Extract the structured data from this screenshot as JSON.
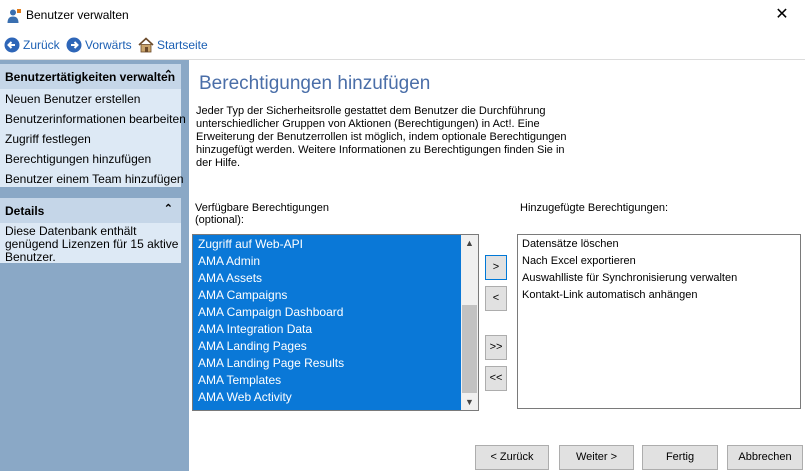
{
  "window": {
    "title": "Benutzer verwalten",
    "close_symbol": "✕"
  },
  "nav": {
    "back": "Zurück",
    "forward": "Vorwärts",
    "home": "Startseite"
  },
  "sidebar": {
    "tasks": {
      "heading": "Benutzertätigkeiten verwalten",
      "items": [
        "Neuen Benutzer erstellen",
        "Benutzerinformationen bearbeiten",
        "Zugriff festlegen",
        "Berechtigungen hinzufügen",
        "Benutzer einem Team hinzufügen"
      ]
    },
    "details": {
      "heading": "Details",
      "text": "Diese Datenbank enthält genügend Lizenzen für 15 aktive Benutzer."
    },
    "collapse_symbol": "⌃"
  },
  "main": {
    "title": "Berechtigungen hinzufügen",
    "intro": "Jeder Typ der Sicherheitsrolle gestattet dem Benutzer die Durchführung unterschiedlicher Gruppen von Aktionen (Berechtigungen) in Act!. Eine Erweiterung der Benutzerrollen ist möglich, indem optionale Berechtigungen hinzugefügt werden. Weitere Informationen zu Berechtigungen finden Sie in der Hilfe.",
    "available_label": "Verfügbare Berechtigungen (optional):",
    "added_label": "Hinzugefügte Berechtigungen:",
    "available_items": [
      "Zugriff auf Web-API",
      "AMA Admin",
      "AMA Assets",
      "AMA Campaigns",
      "AMA Campaign Dashboard",
      "AMA Integration Data",
      "AMA Landing Pages",
      "AMA Landing Page Results",
      "AMA Templates",
      "AMA Web Activity"
    ],
    "added_items": [
      "Datensätze löschen",
      "Nach Excel exportieren",
      "Auswahlliste für Synchronisierung verwalten",
      "Kontakt-Link automatisch anhängen"
    ],
    "move_buttons": {
      "add": ">",
      "remove": "<",
      "add_all": ">>",
      "remove_all": "<<"
    },
    "scroll": {
      "up": "▲",
      "down": "▼"
    },
    "buttons": {
      "back": "< Zurück",
      "next": "Weiter >",
      "finish": "Fertig",
      "cancel": "Abbrechen"
    }
  },
  "colors": {
    "selection": "#0a78d7",
    "sidebar": "#8aa8c6",
    "title_blue": "#4a6ea8",
    "link_blue": "#1b5fb3"
  }
}
